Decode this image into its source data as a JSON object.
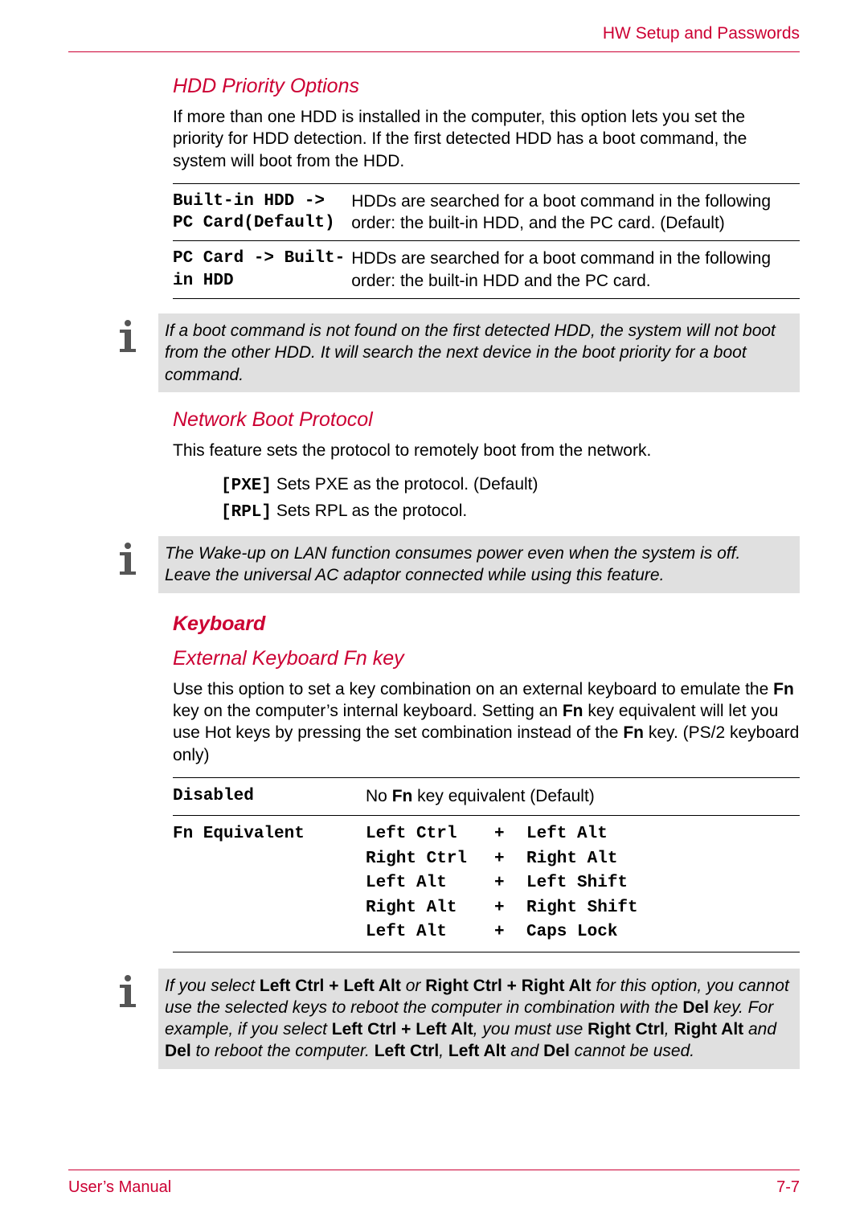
{
  "header": {
    "title": "HW Setup and Passwords"
  },
  "hdd": {
    "heading": "HDD Priority Options",
    "intro": "If more than one HDD is installed in the computer, this option lets you set the priority for HDD detection. If the first detected HDD has a boot command, the system will boot from the HDD.",
    "rows": [
      {
        "key": "Built-in HDD ->\nPC Card(Default)",
        "desc": "HDDs are searched for a boot command in the following order: the built-in HDD, and the PC card. (Default)"
      },
      {
        "key": "PC Card -> Built-\nin HDD",
        "desc": "HDDs are searched for a boot command in the following order: the built-in HDD and the PC card."
      }
    ]
  },
  "note1": "If a boot command is not found on the first detected HDD, the system will not boot from the other HDD. It will search the next device in the boot priority for a boot command.",
  "net": {
    "heading": "Network Boot Protocol",
    "intro": "This feature sets the protocol to remotely boot from the network.",
    "pxe_key": "[PXE]",
    "pxe_desc": " Sets PXE as the protocol. (Default)",
    "rpl_key": "[RPL]",
    "rpl_desc": " Sets RPL as the protocol."
  },
  "note2": "The Wake-up on LAN function consumes power even when the system is off. Leave the universal AC adaptor connected while using this feature.",
  "kbd": {
    "section": "Keyboard",
    "heading": "External Keyboard Fn key",
    "p1a": "Use this option to set a key combination on an external keyboard to emulate the ",
    "p1b": " key on the computer’s internal keyboard. Setting an ",
    "p1c": " key equivalent will let you use Hot keys by pressing the set combination instead of the ",
    "p1d": " key. (PS/2 keyboard only)",
    "fn": "Fn",
    "rows": [
      {
        "key": "Disabled",
        "plain_a": "No ",
        "plain_b": " key equivalent (Default)",
        "bold": "Fn"
      },
      {
        "key": "Fn Equivalent",
        "combos": [
          {
            "c1": "Left Ctrl",
            "c2": "Left Alt"
          },
          {
            "c1": "Right Ctrl",
            "c2": "Right Alt"
          },
          {
            "c1": "Left Alt",
            "c2": "Left Shift"
          },
          {
            "c1": "Right Alt",
            "c2": "Right Shift"
          },
          {
            "c1": "Left Alt",
            "c2": "Caps Lock"
          }
        ]
      }
    ]
  },
  "note3": {
    "t1": "If you select ",
    "b1": "Left Ctrl + Left Alt",
    "t2": " or ",
    "b2": "Right Ctrl + Right Alt",
    "t3": " for this option, you cannot use the selected keys to reboot the computer in combination with the ",
    "b3": "Del",
    "t4": " key. For example, if you select ",
    "b4": "Left Ctrl + Left Alt",
    "t5": ", you must use ",
    "b5": "Right Ctrl",
    "t6": ", ",
    "b6": "Right Alt",
    "t7": " and ",
    "b7": "Del",
    "t8": " to reboot the computer. ",
    "b8": "Left Ctrl",
    "t9": ", ",
    "b9": "Left Alt",
    "t10": " and ",
    "b10": "Del",
    "t11": " cannot be used."
  },
  "footer": {
    "left": "User’s Manual",
    "right": "7-7"
  }
}
